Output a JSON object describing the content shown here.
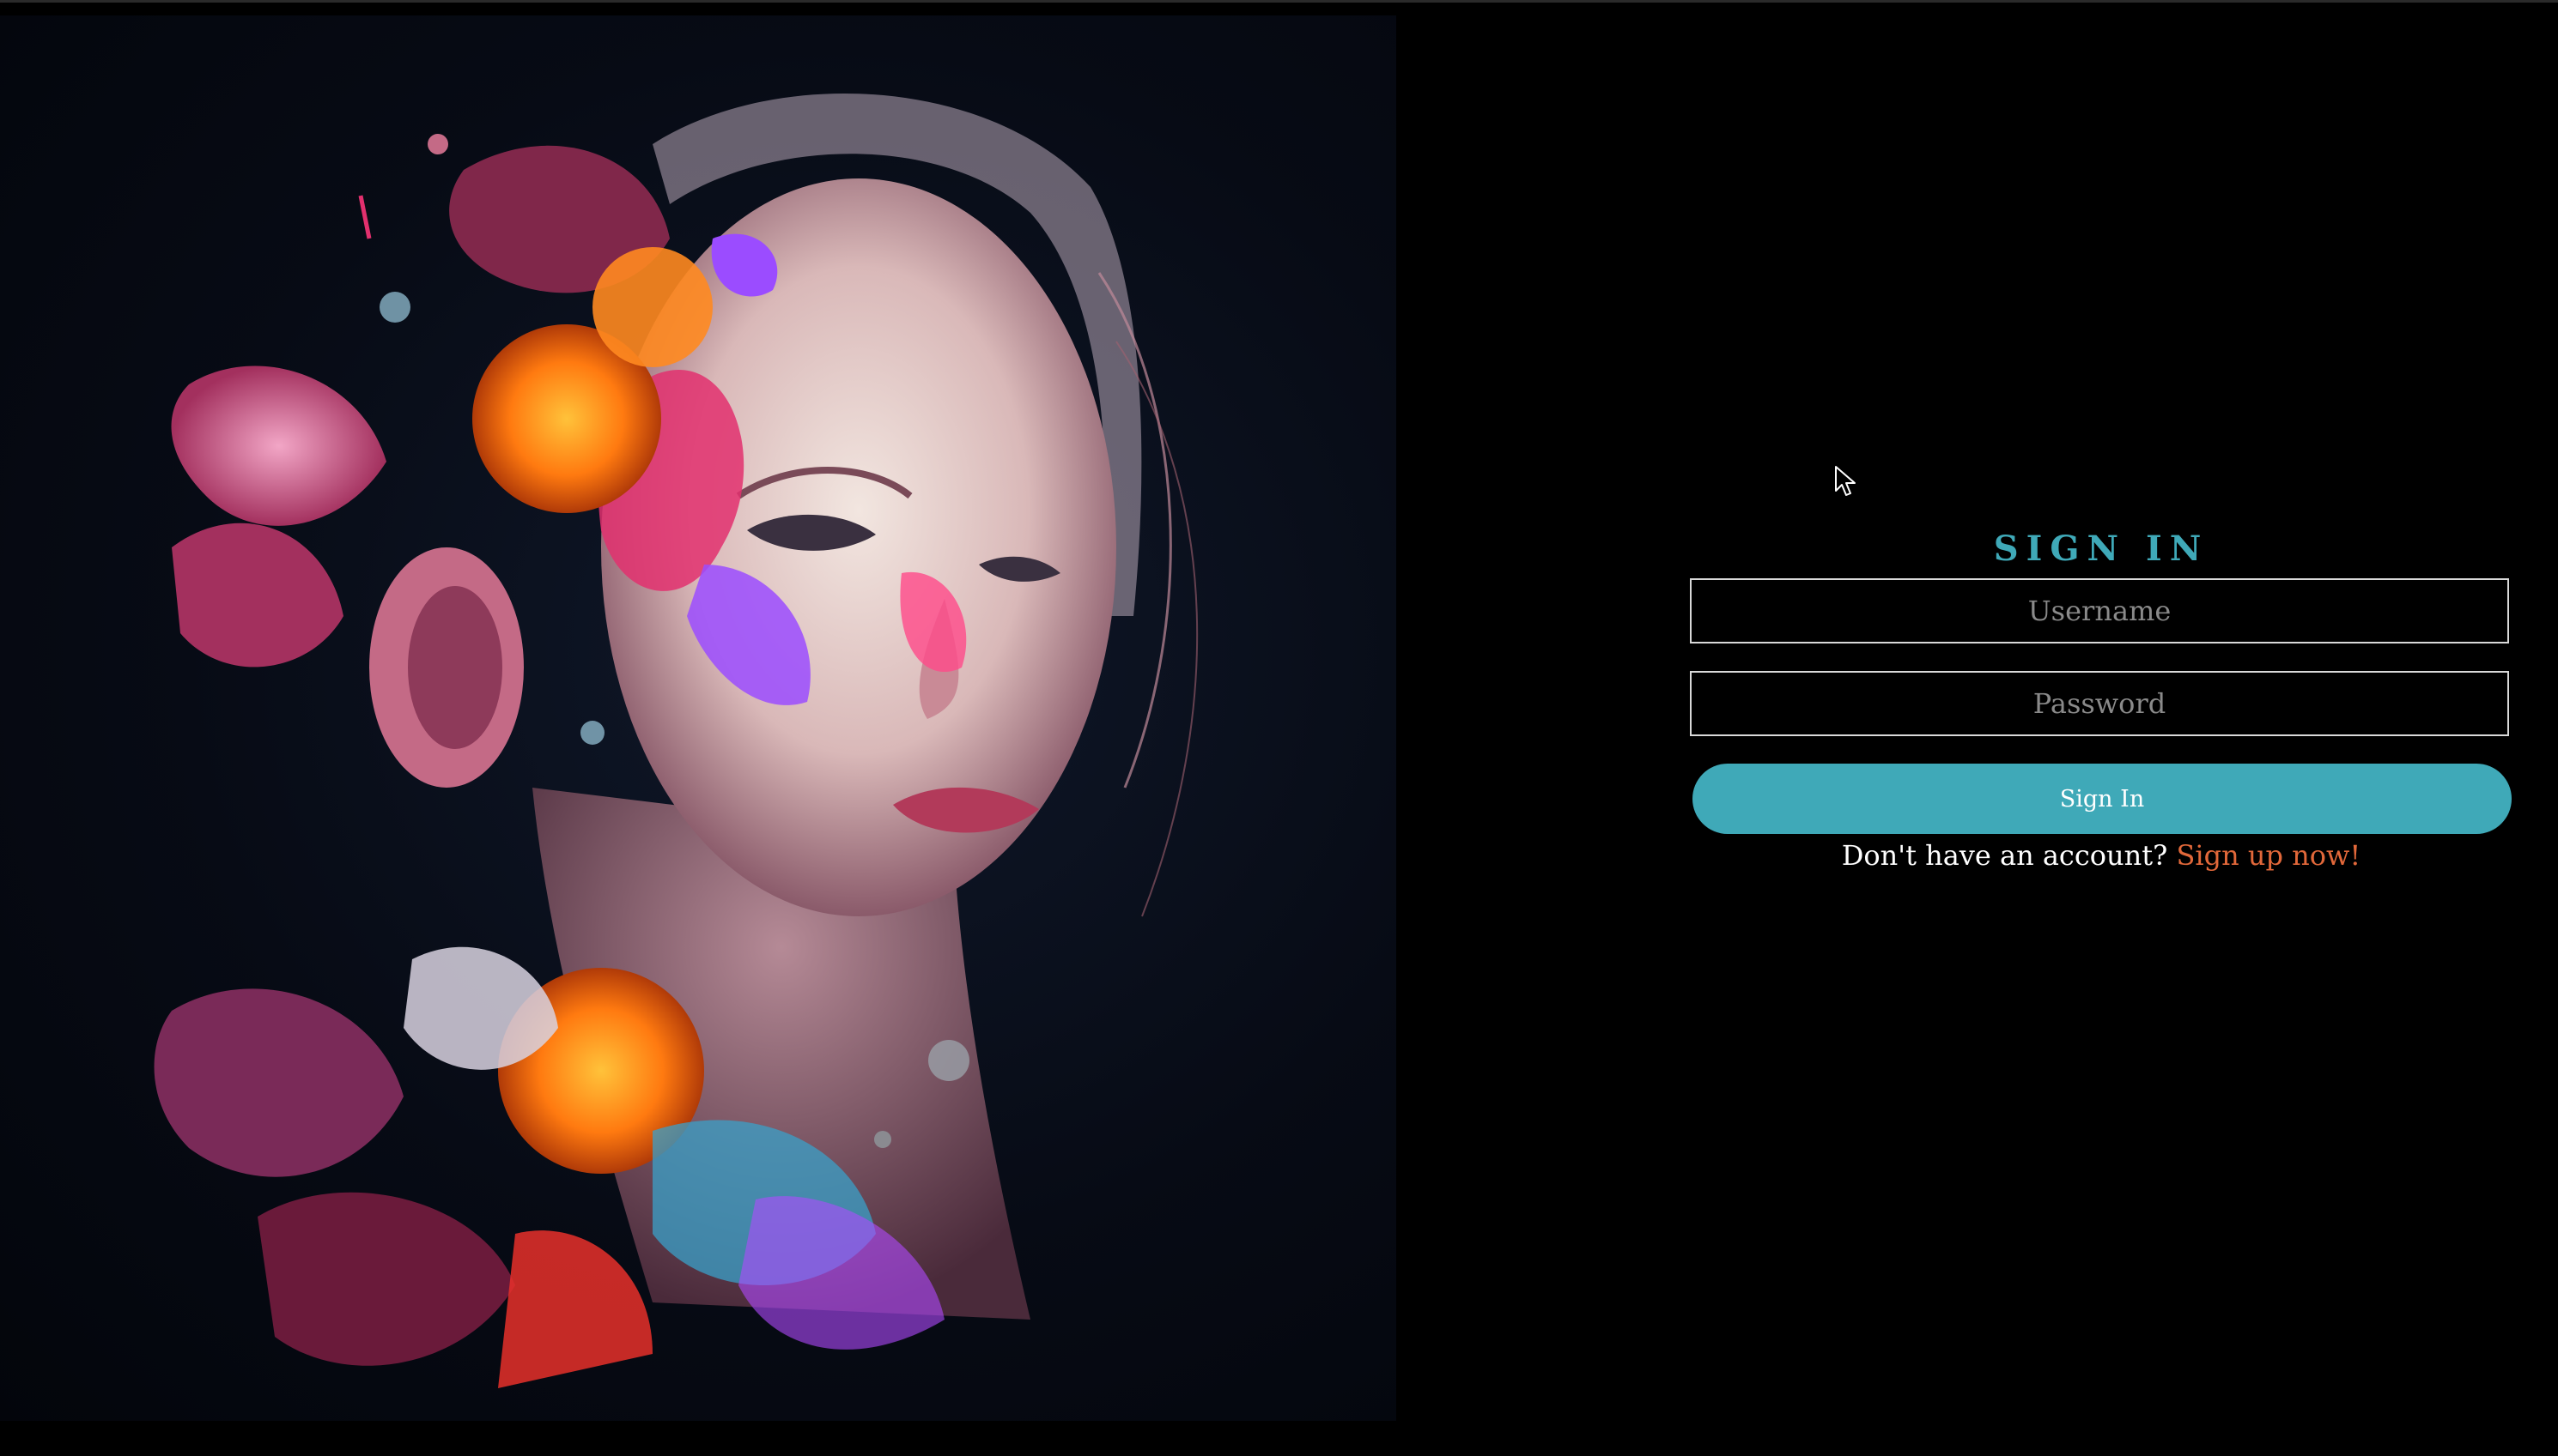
{
  "signin": {
    "title": "SIGN IN",
    "username_placeholder": "Username",
    "password_placeholder": "Password",
    "button_label": "Sign In",
    "prompt_text": "Don't have an account?",
    "signup_link": "Sign up now!"
  },
  "colors": {
    "accent": "#3fa9b8",
    "link": "#e2683a",
    "background": "#000000"
  },
  "hero": {
    "icon": "abstract-painted-portrait"
  }
}
